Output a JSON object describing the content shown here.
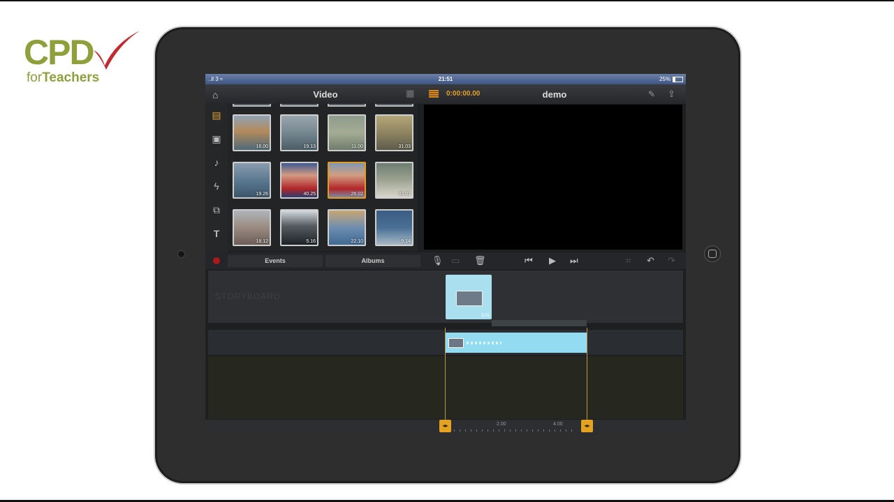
{
  "logo": {
    "main": "CPD",
    "prefix": "for",
    "suffix": "Teachers"
  },
  "status_bar": {
    "carrier": "..ll 3 ≈",
    "time": "21:51",
    "battery": "25%"
  },
  "library": {
    "title": "Video",
    "tabs": [
      "Events",
      "Albums"
    ],
    "thumbnails": [
      {
        "duration": "16.00",
        "selected": false
      },
      {
        "duration": "19.13",
        "selected": false
      },
      {
        "duration": "11.00",
        "selected": false
      },
      {
        "duration": "31.03",
        "selected": false
      },
      {
        "duration": "19.26",
        "selected": false
      },
      {
        "duration": "40.25",
        "selected": false
      },
      {
        "duration": "26.02",
        "selected": true
      },
      {
        "duration": "43.01",
        "selected": false
      },
      {
        "duration": "18.12",
        "selected": false
      },
      {
        "duration": "5.16",
        "selected": false
      },
      {
        "duration": "22.10",
        "selected": false
      },
      {
        "duration": "9.14",
        "selected": false
      }
    ]
  },
  "project": {
    "timecode": "0:00:00.00",
    "name": "demo"
  },
  "storyboard": {
    "label": "STORYBOARD",
    "clip_duration": "5.01"
  },
  "timeline": {
    "ruler_labels": [
      "2.00",
      "4.00"
    ]
  },
  "colors": {
    "accent": "#e39a1e",
    "clip": "#93dbf0",
    "status_bar": "#4c6490"
  },
  "icons": [
    "home-icon",
    "grid-icon",
    "film-icon",
    "edit-icon",
    "share-icon",
    "video-library-icon",
    "photo-icon",
    "music-icon",
    "effects-icon",
    "transitions-icon",
    "text-icon",
    "record-icon",
    "microphone-icon",
    "trash-icon",
    "skip-back-icon",
    "play-icon",
    "skip-forward-icon",
    "undo-icon"
  ]
}
